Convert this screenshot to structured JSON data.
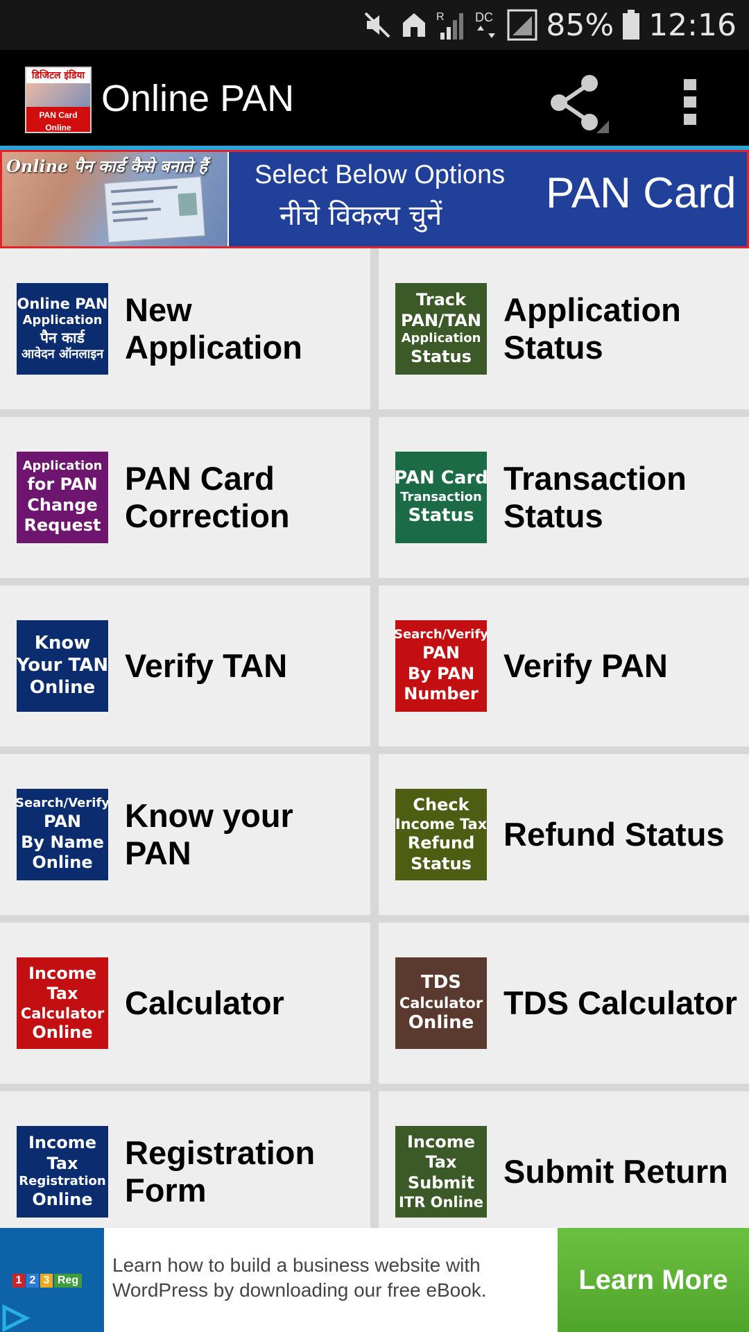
{
  "status_bar": {
    "battery_percent": "85%",
    "time": "12:16",
    "signal_label": "R",
    "data_label": "DC"
  },
  "app_bar": {
    "title": "Online PAN",
    "logo_top": "डिजिटल इंडिया",
    "logo_line1": "PAN Card",
    "logo_line2": "Online",
    "share_icon": "share-icon",
    "overflow_icon": "more-vert-icon"
  },
  "banner": {
    "photo_text": "Online पैन कार्ड कैसे बनाते हैं",
    "select_text": "Select Below Options",
    "hindi_text": "नीचे विकल्प चुनें",
    "pan_text": "PAN Card",
    "border_color": "#e0252a",
    "background_color": "#21409a"
  },
  "tiles": [
    {
      "icon_bg": "#0b2c6e",
      "icon_lines": [
        "Online PAN",
        "Application",
        "पैन कार्ड",
        "आवेदन ऑनलाइन"
      ],
      "label_lines": [
        "New",
        "Application"
      ]
    },
    {
      "icon_bg": "#3b5a28",
      "icon_lines": [
        "Track",
        "PAN/TAN",
        "Application",
        "Status"
      ],
      "label_lines": [
        "Application",
        "Status"
      ]
    },
    {
      "icon_bg": "#6e166f",
      "icon_lines": [
        "Application",
        "for PAN",
        "Change",
        "Request"
      ],
      "label_lines": [
        "PAN Card",
        "Correction"
      ]
    },
    {
      "icon_bg": "#1a6b46",
      "icon_lines": [
        "PAN Card",
        "Transaction",
        "Status"
      ],
      "label_lines": [
        "Transaction",
        "Status"
      ]
    },
    {
      "icon_bg": "#0b2c6e",
      "icon_lines": [
        "Know",
        "Your TAN",
        "Online"
      ],
      "label_lines": [
        "Verify TAN"
      ]
    },
    {
      "icon_bg": "#c40f12",
      "icon_lines": [
        "Search/Verify",
        "PAN",
        "By PAN",
        "Number"
      ],
      "label_lines": [
        "Verify PAN"
      ]
    },
    {
      "icon_bg": "#0b2c6e",
      "icon_lines": [
        "Search/Verify",
        "PAN",
        "By Name",
        "Online"
      ],
      "label_lines": [
        "Know your PAN"
      ]
    },
    {
      "icon_bg": "#4d5d12",
      "icon_lines": [
        "Check",
        "Income Tax",
        "Refund",
        "Status"
      ],
      "label_lines": [
        "Refund Status"
      ]
    },
    {
      "icon_bg": "#c40f12",
      "icon_lines": [
        "Income",
        "Tax",
        "Calculator",
        "Online"
      ],
      "label_lines": [
        "Calculator"
      ]
    },
    {
      "icon_bg": "#5a3a2e",
      "icon_lines": [
        "TDS",
        "Calculator",
        "Online"
      ],
      "label_lines": [
        "TDS Calculator"
      ]
    },
    {
      "icon_bg": "#0b2c6e",
      "icon_lines": [
        "Income",
        "Tax",
        "Registration",
        "Online"
      ],
      "label_lines": [
        "Registration",
        "Form"
      ]
    },
    {
      "icon_bg": "#3b5a28",
      "icon_lines": [
        "Income",
        "Tax",
        "Submit",
        "ITR Online"
      ],
      "label_lines": [
        "Submit Return"
      ]
    }
  ],
  "ad": {
    "logo_text": "123 Reg",
    "text": "Learn how to build a business website with WordPress by downloading our free eBook.",
    "cta": "Learn More",
    "cta_color": "#5db134"
  }
}
